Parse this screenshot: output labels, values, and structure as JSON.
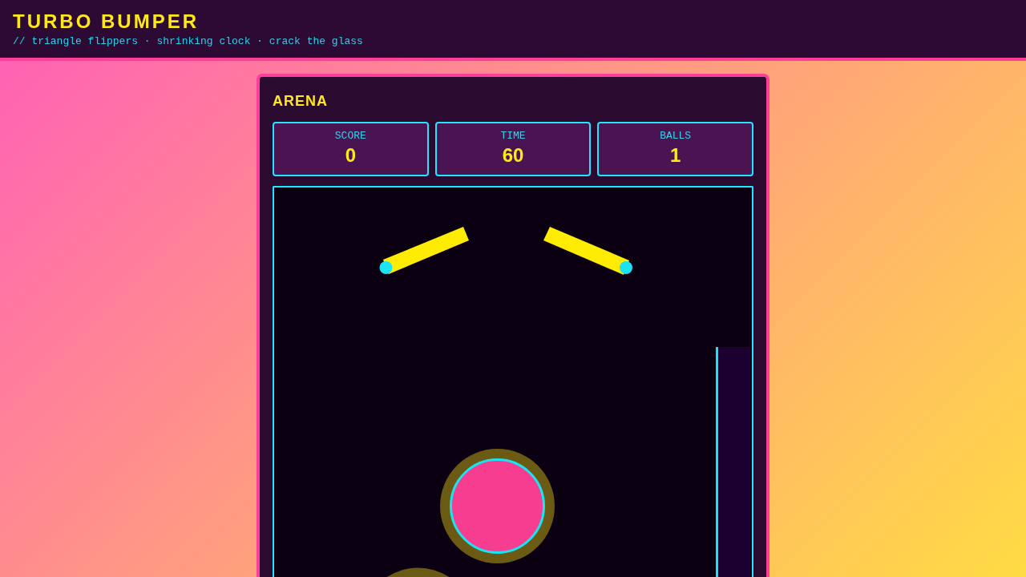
{
  "header": {
    "title": "TURBO BUMPER",
    "subtitle": "// triangle flippers · shrinking clock · crack the glass"
  },
  "arena": {
    "title": "ARENA",
    "stats": [
      {
        "label": "SCORE",
        "value": "0"
      },
      {
        "label": "TIME",
        "value": "60"
      },
      {
        "label": "BALLS",
        "value": "1"
      }
    ]
  }
}
